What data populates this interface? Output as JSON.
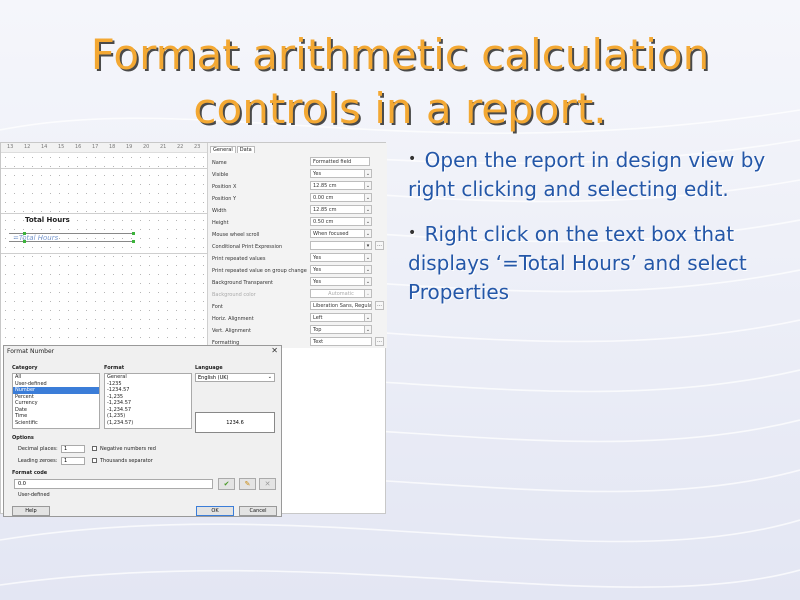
{
  "slide": {
    "title": "Format arithmetic calculation controls in a report.",
    "bullets": [
      "Open the report in design view by right clicking and selecting edit.",
      "Right click on the text box that displays ‘=Total Hours’ and select Properties"
    ]
  },
  "design": {
    "ruler": [
      "13",
      "12",
      "14",
      "15",
      "16",
      "17",
      "18",
      "19",
      "20",
      "21",
      "22",
      "23"
    ],
    "label_total_hours": "Total Hours",
    "textbox_total_hours": "=Total Hours"
  },
  "properties": {
    "tabs": [
      "General",
      "Data"
    ],
    "rows": [
      {
        "label": "Name",
        "value": "Formatted field",
        "control": "text"
      },
      {
        "label": "Visible",
        "value": "Yes",
        "control": "dropdown"
      },
      {
        "label": "Position X",
        "value": "12.85 cm",
        "control": "spin"
      },
      {
        "label": "Position Y",
        "value": "0.00 cm",
        "control": "spin"
      },
      {
        "label": "Width",
        "value": "12.85 cm",
        "control": "spin"
      },
      {
        "label": "Height",
        "value": "0.50 cm",
        "control": "spin"
      },
      {
        "label": "Mouse wheel scroll",
        "value": "When focused",
        "control": "dropdown"
      },
      {
        "label": "Conditional Print Expression",
        "value": "",
        "control": "dropdown-dots"
      },
      {
        "label": "Print repeated values",
        "value": "Yes",
        "control": "dropdown"
      },
      {
        "label": "Print repeated value on group change",
        "value": "Yes",
        "control": "dropdown"
      },
      {
        "label": "Background Transparent",
        "value": "Yes",
        "control": "dropdown"
      },
      {
        "label": "Background color",
        "value": "Automatic",
        "control": "disabled"
      },
      {
        "label": "Font",
        "value": "Liberation Sans, Regular,",
        "control": "dots"
      },
      {
        "label": "Horiz. Alignment",
        "value": "Left",
        "control": "dropdown"
      },
      {
        "label": "Vert. Alignment",
        "value": "Top",
        "control": "dropdown"
      },
      {
        "label": "Formatting",
        "value": "Text",
        "control": "dots"
      }
    ]
  },
  "dialog": {
    "title": "Format Number",
    "close": "✕",
    "category_label": "Category",
    "categories": [
      "All",
      "User-defined",
      "Number",
      "Percent",
      "Currency",
      "Date",
      "Time",
      "Scientific"
    ],
    "selected_category": "Number",
    "format_label": "Format",
    "formats": [
      "General",
      "-1235",
      "-1234.57",
      "-1,235",
      "-1,234.57",
      "-1,234.57",
      "(1,235)",
      "(1,234.57)"
    ],
    "language_label": "Language",
    "language_value": "English (UK)",
    "preview_value": "1234.6",
    "options_label": "Options",
    "decimal_places_label": "Decimal places:",
    "decimal_places_value": "1",
    "leading_zeroes_label": "Leading zeroes:",
    "leading_zeroes_value": "1",
    "negative_red_label": "Negative numbers red",
    "thousands_sep_label": "Thousands separator",
    "format_code_label": "Format code",
    "format_code_value": "0.0",
    "format_code_caption": "User-defined",
    "help_label": "Help",
    "ok_label": "OK",
    "cancel_label": "Cancel"
  },
  "colors": {
    "title": "#f3a833",
    "bullet_text": "#2457a8",
    "selection": "#3b7dd8"
  }
}
